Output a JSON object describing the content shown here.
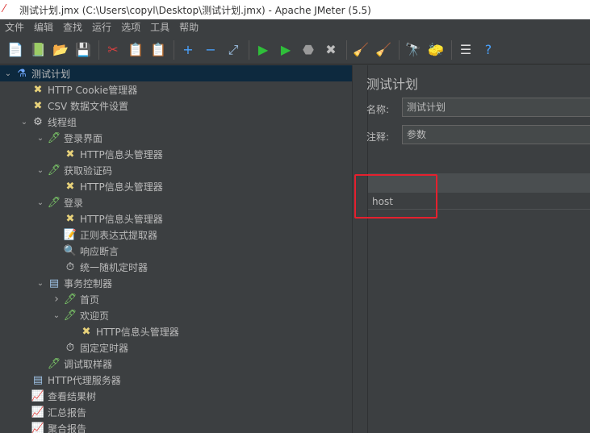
{
  "window": {
    "title": "测试计划.jmx (C:\\Users\\copyl\\Desktop\\测试计划.jmx) - Apache JMeter (5.5)"
  },
  "menu": [
    "文件",
    "编辑",
    "查找",
    "运行",
    "选项",
    "工具",
    "帮助"
  ],
  "toolbar": [
    {
      "icon": "new-icon",
      "glyph": "📄"
    },
    {
      "icon": "templates-icon",
      "glyph": "📗"
    },
    {
      "icon": "open-icon",
      "glyph": "📂"
    },
    {
      "icon": "save-icon",
      "glyph": "💾"
    },
    {
      "icon": "cut-icon",
      "glyph": "✂"
    },
    {
      "icon": "copy-icon",
      "glyph": "📋"
    },
    {
      "icon": "paste-icon",
      "glyph": "📋"
    },
    {
      "icon": "expand-icon",
      "glyph": "+"
    },
    {
      "icon": "collapse-icon",
      "glyph": "−"
    },
    {
      "icon": "toggle-icon",
      "glyph": "⤢"
    },
    {
      "icon": "start-icon",
      "glyph": "▶"
    },
    {
      "icon": "start-no-pause-icon",
      "glyph": "▶"
    },
    {
      "icon": "stop-icon",
      "glyph": "⬣"
    },
    {
      "icon": "shutdown-icon",
      "glyph": "✖"
    },
    {
      "icon": "clear-icon",
      "glyph": "🧹"
    },
    {
      "icon": "clear-all-icon",
      "glyph": "🧹"
    },
    {
      "icon": "search-icon",
      "glyph": "🔭"
    },
    {
      "icon": "reset-search-icon",
      "glyph": "🧽"
    },
    {
      "icon": "function-helper-icon",
      "glyph": "☰"
    },
    {
      "icon": "help-icon",
      "glyph": "?"
    }
  ],
  "tree": [
    {
      "label": "测试计划",
      "depth": 0,
      "arrow": "v",
      "icon": "flask-icon",
      "glyph": "⚗",
      "selected": true
    },
    {
      "label": "HTTP Cookie管理器",
      "depth": 1,
      "arrow": "",
      "icon": "tools-icon",
      "glyph": "✖"
    },
    {
      "label": "CSV 数据文件设置",
      "depth": 1,
      "arrow": "",
      "icon": "tools-icon",
      "glyph": "✖"
    },
    {
      "label": "线程组",
      "depth": 1,
      "arrow": "v",
      "icon": "gear-icon",
      "glyph": "⚙"
    },
    {
      "label": "登录界面",
      "depth": 2,
      "arrow": "v",
      "icon": "sampler-icon",
      "glyph": "🖊"
    },
    {
      "label": "HTTP信息头管理器",
      "depth": 3,
      "arrow": "",
      "icon": "tools-icon",
      "glyph": "✖"
    },
    {
      "label": "获取验证码",
      "depth": 2,
      "arrow": "v",
      "icon": "sampler-icon",
      "glyph": "🖊"
    },
    {
      "label": "HTTP信息头管理器",
      "depth": 3,
      "arrow": "",
      "icon": "tools-icon",
      "glyph": "✖"
    },
    {
      "label": "登录",
      "depth": 2,
      "arrow": "v",
      "icon": "sampler-icon",
      "glyph": "🖊"
    },
    {
      "label": "HTTP信息头管理器",
      "depth": 3,
      "arrow": "",
      "icon": "tools-icon",
      "glyph": "✖"
    },
    {
      "label": "正则表达式提取器",
      "depth": 3,
      "arrow": "",
      "icon": "extractor-icon",
      "glyph": "📝"
    },
    {
      "label": "响应断言",
      "depth": 3,
      "arrow": "",
      "icon": "assertion-icon",
      "glyph": "🔍"
    },
    {
      "label": "统一随机定时器",
      "depth": 3,
      "arrow": "",
      "icon": "timer-icon",
      "glyph": "⏱"
    },
    {
      "label": "事务控制器",
      "depth": 2,
      "arrow": "v",
      "icon": "controller-icon",
      "glyph": "▤"
    },
    {
      "label": "首页",
      "depth": 3,
      "arrow": ">",
      "icon": "sampler-icon",
      "glyph": "🖊"
    },
    {
      "label": "欢迎页",
      "depth": 3,
      "arrow": "v",
      "icon": "sampler-icon",
      "glyph": "🖊"
    },
    {
      "label": "HTTP信息头管理器",
      "depth": 4,
      "arrow": "",
      "icon": "tools-icon",
      "glyph": "✖"
    },
    {
      "label": "固定定时器",
      "depth": 3,
      "arrow": "",
      "icon": "timer-icon",
      "glyph": "⏱"
    },
    {
      "label": "调试取样器",
      "depth": 2,
      "arrow": "",
      "icon": "sampler-icon",
      "glyph": "🖊"
    },
    {
      "label": "HTTP代理服务器",
      "depth": 1,
      "arrow": "",
      "icon": "proxy-icon",
      "glyph": "▤"
    },
    {
      "label": "查看结果树",
      "depth": 1,
      "arrow": "",
      "icon": "listener-icon",
      "glyph": "📈"
    },
    {
      "label": "汇总报告",
      "depth": 1,
      "arrow": "",
      "icon": "listener-icon",
      "glyph": "📈"
    },
    {
      "label": "聚合报告",
      "depth": 1,
      "arrow": "",
      "icon": "listener-icon",
      "glyph": "📈"
    }
  ],
  "panel": {
    "title": "测试计划",
    "name_label": "名称:",
    "name_value": "测试计划",
    "comment_label": "注释:",
    "comment_value": "参数",
    "table_rows": [
      "host"
    ]
  },
  "colors": {
    "highlight": "#e5202e",
    "selected_row": "#0d293e"
  }
}
